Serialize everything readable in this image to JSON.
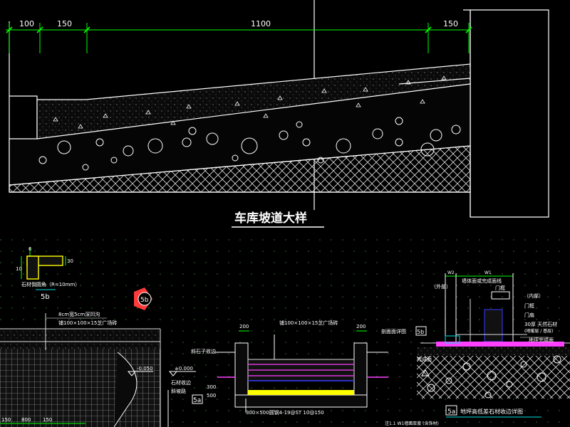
{
  "dimensions": {
    "d1": "100",
    "d2": "150",
    "d3": "1100",
    "d4": "150"
  },
  "title": "车库坡道大样",
  "callouts": {
    "c1_mark": "5b",
    "c1_label": "石材倒圆角（R=10mm）",
    "c1_num_left": "6",
    "c1_num_mid": "10",
    "c1_num_right": "30",
    "c2_mark": "5b",
    "c3_mark": "5a",
    "c4_mark": "5a",
    "c5_mark": "5b"
  },
  "labels": {
    "l1": "8cm宽5cm深凹沟",
    "l2": "铺100×100×15芝广场砖",
    "l3": "铺100×100×15芝广场砖",
    "l4": "斜石子收边",
    "l5": "石材收边",
    "l6": "斜坡路",
    "l7": "300×500圆钢4-19@ST 10@150",
    "l8": "±0.000",
    "l9": "-0.050",
    "l10": "墙体面或完成面线",
    "l11": "门框",
    "l12": "（外部）",
    "l13": "（内部）",
    "l14": "门框",
    "l15": "门扇",
    "l16": "30厚 天然石材",
    "l17": "(地暖层 / 基层)",
    "l18": "地坪完成面",
    "l19": "剖面面详图",
    "l20": "完成面",
    "l21": "地坪高低差石材收边详图",
    "l22": "注1.1  W1墙面厚度  (含饰材)",
    "n200a": "200",
    "n200b": "200",
    "n300": "300",
    "n500": "500",
    "n150a": "150",
    "n800": "800",
    "n150b": "150",
    "w2": "W2",
    "w1": "W1"
  },
  "colors": {
    "background": "#000000",
    "line": "#ffffff",
    "dimension": "#00ff00",
    "grid": "#1c6b1c",
    "callout": "#ff3a3a",
    "accent_yellow": "#ffff00",
    "accent_magenta": "#ff40ff",
    "accent_blue": "#3a3aff",
    "accent_cyan": "#00e0e0"
  }
}
